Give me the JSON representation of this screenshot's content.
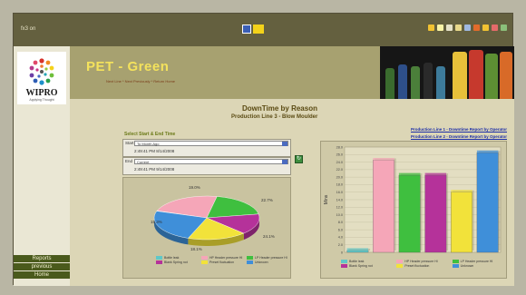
{
  "window": {
    "brand": "fx3 on",
    "icon_colors": [
      "#f1c232",
      "#f9f3a6",
      "#e5e1c8",
      "#e8d88a",
      "#9fb8e0",
      "#e26b2b",
      "#f1c232",
      "#e56a6a",
      "#8bbf7a"
    ]
  },
  "sidebar": {
    "logo_text": "WIPRO",
    "logo_tagline": "Applying Thought",
    "nav": [
      {
        "label": "Reports"
      },
      {
        "label": "previous"
      },
      {
        "label": "Home"
      }
    ]
  },
  "banner": {
    "title": "PET - Green",
    "subtitle": "Next Line * Next Previously * Return Home"
  },
  "page": {
    "title": "DownTime by Reason",
    "subtitle": "Production Line 3 - Blow Moulder",
    "links": [
      "Production Line 1 - Downtime Report by Operator",
      "Production Line 2 - Downtime Report by Operator"
    ],
    "section_label": "Select Start & End Time"
  },
  "start": {
    "label": "Start",
    "select": "To Month Ago",
    "datetime": "2:49:41 PM 8/14/2008"
  },
  "end": {
    "label": "End",
    "select": "Current",
    "datetime": "2:49:41 PM 9/14/2008"
  },
  "go_label": "↻",
  "chart_data": [
    {
      "type": "pie",
      "slices": [
        {
          "label": "Bottle leak",
          "value": 0.3,
          "color": "#5fc7c8"
        },
        {
          "label": "HP Header pressure HI",
          "value": 22.7,
          "color": "#f5a6b8"
        },
        {
          "label": "LP Header pressure HI",
          "value": 19.0,
          "color": "#3fbf3f"
        },
        {
          "label": "Blank Spring not",
          "value": 15.3,
          "color": "#b5329a"
        },
        {
          "label": "Preset fluctuation",
          "value": 18.1,
          "color": "#f2e23a"
        },
        {
          "label": "Unknown",
          "value": 24.1,
          "color": "#3f8fd9"
        }
      ],
      "data_labels": [
        "19.0%",
        "22.7%",
        "15.3%",
        "18.1%",
        "24.1%"
      ]
    },
    {
      "type": "bar",
      "categories": [
        "Bottle leak",
        "HP Header pressure HI",
        "LP Header pressure HI",
        "Blank Spring not",
        "Preset fluctuation",
        "Unknown"
      ],
      "values": [
        0.5,
        24.5,
        20.5,
        20.5,
        16.0,
        26.5
      ],
      "colors": [
        "#5fc7c8",
        "#f5a6b8",
        "#3fbf3f",
        "#b5329a",
        "#f2e23a",
        "#3f8fd9"
      ],
      "ylabel": "Mins",
      "ylim": [
        0,
        28
      ],
      "yticks": [
        "0",
        "2.0",
        "4.0",
        "6.0",
        "8.0",
        "10.0",
        "12.0",
        "14.0",
        "16.0",
        "18.0",
        "20.0",
        "22.0",
        "24.0",
        "26.0",
        "28.0"
      ],
      "grid": true
    }
  ]
}
